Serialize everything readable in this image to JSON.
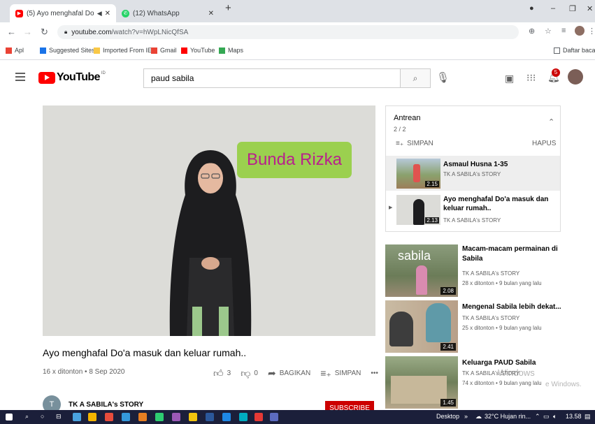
{
  "browser": {
    "tabs": [
      {
        "title": "(5) Ayo menghafal Do'a mas",
        "active": true,
        "favicon": "youtube-icon",
        "color": "#ff0000"
      },
      {
        "title": "(12) WhatsApp",
        "active": false,
        "favicon": "whatsapp-icon",
        "color": "#25d366"
      }
    ],
    "new_tab": "+",
    "address": {
      "domain": "youtube.com",
      "path": "/watch?v=hWpLNicQfSA"
    },
    "bookmarks": [
      {
        "label": "Apl",
        "icon": "apps-grid-icon",
        "color": "#ea4335"
      },
      {
        "label": "Suggested Sites",
        "icon": "bing-icon",
        "color": "#1a73e8"
      },
      {
        "label": "Imported From IE",
        "icon": "folder-icon",
        "color": "#f9c846"
      },
      {
        "label": "Gmail",
        "icon": "gmail-icon",
        "color": "#ea4335"
      },
      {
        "label": "YouTube",
        "icon": "youtube-icon",
        "color": "#ff0000"
      },
      {
        "label": "Maps",
        "icon": "maps-icon",
        "color": "#34a853"
      }
    ],
    "reading_list": "Daftar bacaan"
  },
  "youtube": {
    "logo_text": "YouTube",
    "country": "ID",
    "search_value": "paud sabila",
    "notification_count": "5"
  },
  "video": {
    "overlay_text": "Bunda Rizka",
    "title": "Ayo menghafal Do'a masuk dan keluar rumah..",
    "meta": "16 x ditonton • 8 Sep 2020",
    "likes": "3",
    "dislikes": "0",
    "share_label": "BAGIKAN",
    "save_label": "SIMPAN",
    "more_label": "•••"
  },
  "channel": {
    "avatar_letter": "T",
    "name": "TK A SABILA's STORY",
    "subscribe_label": "SUBSCRIBE"
  },
  "queue": {
    "title": "Antrean",
    "count": "2 / 2",
    "save_label": "SIMPAN",
    "delete_label": "HAPUS",
    "items": [
      {
        "title": "Asmaul Husna 1-35",
        "channel": "TK A SABILA's STORY",
        "duration": "2.15"
      },
      {
        "title": "Ayo menghafal Do'a masuk dan keluar rumah..",
        "channel": "TK A SABILA's STORY",
        "duration": "2.13"
      }
    ]
  },
  "recommendations": [
    {
      "title": "Macam-macam permainan di Sabila",
      "channel": "TK A SABILA's STORY",
      "meta": "28 x ditonton • 9 bulan yang lalu",
      "duration": "2.08",
      "thumb_text": "sabila"
    },
    {
      "title": "Mengenal Sabila lebih dekat...",
      "channel": "TK A SABILA's STORY",
      "meta": "25 x ditonton • 9 bulan yang lalu",
      "duration": "2.41"
    },
    {
      "title": "Keluarga PAUD Sabila",
      "channel": "TK A SABILA's STORY",
      "meta": "74 x ditonton • 9 bulan yang lalu",
      "duration": "1.45"
    }
  ],
  "watermark": {
    "line1": "Windows",
    "line2": "e Windows."
  },
  "taskbar": {
    "desktop_label": "Desktop",
    "weather": "32°C  Hujan rin...",
    "time": "13.58"
  }
}
